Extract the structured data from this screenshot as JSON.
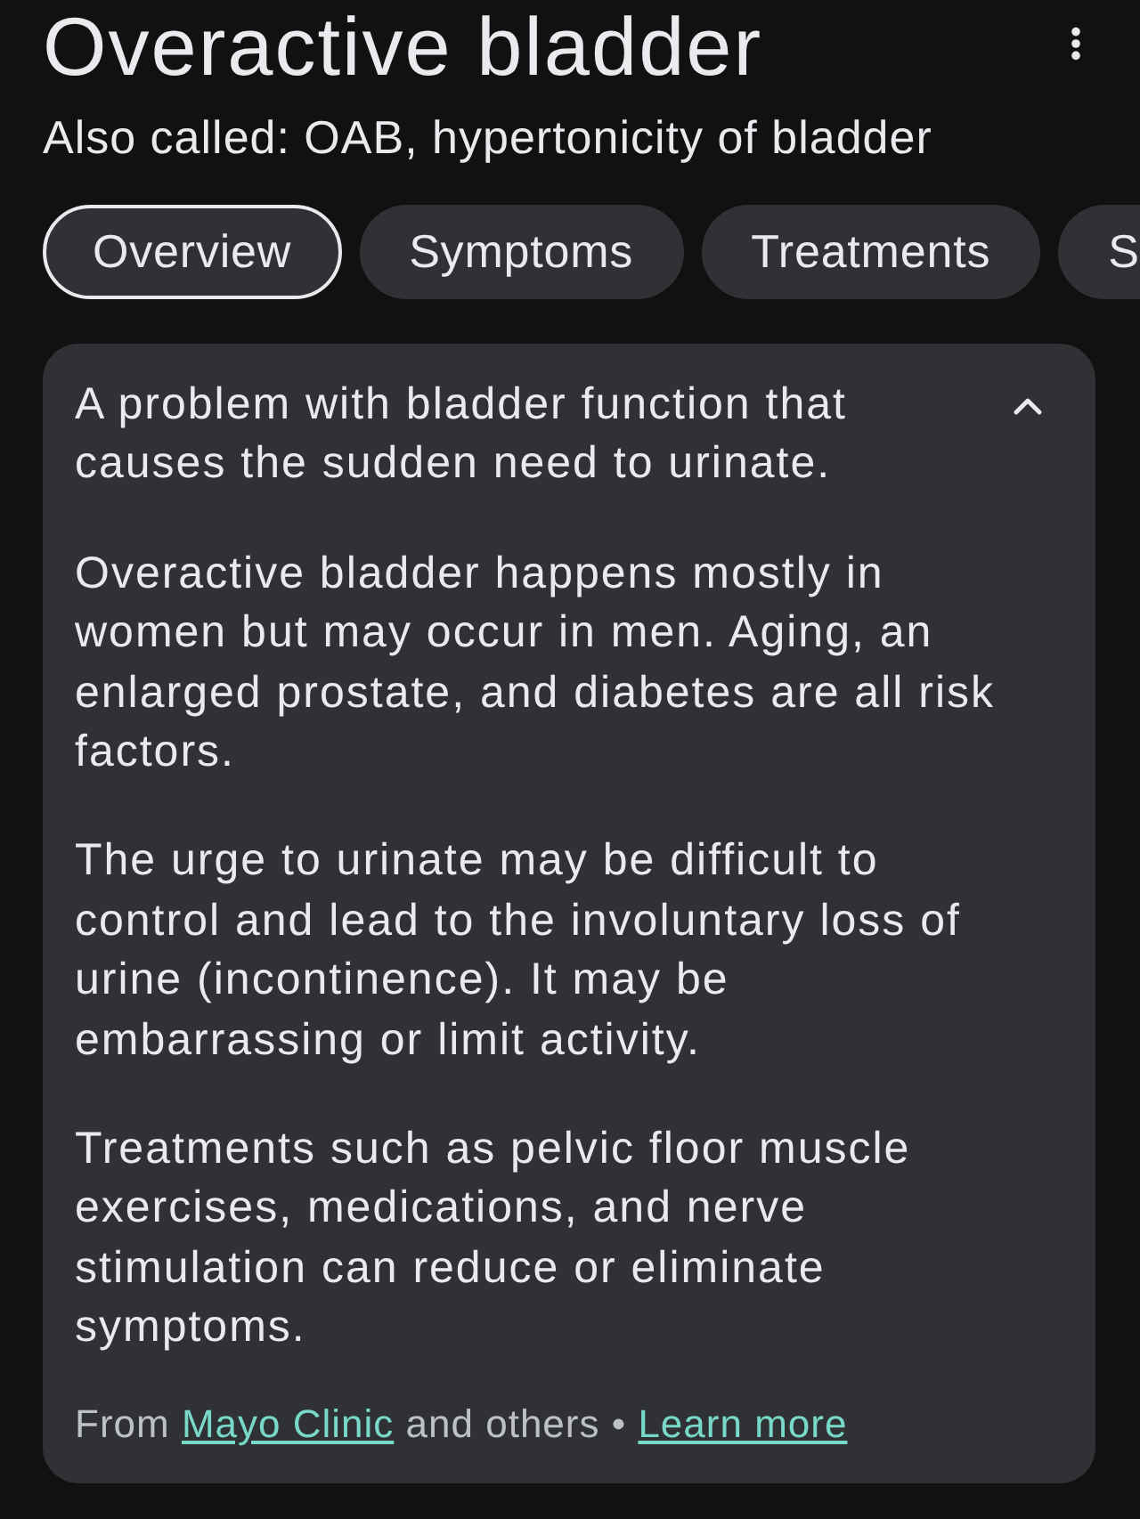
{
  "header": {
    "title": "Overactive bladder",
    "subtitle": "Also called: OAB, hypertonicity of bladder"
  },
  "tabs": [
    {
      "label": "Overview",
      "selected": true
    },
    {
      "label": "Symptoms",
      "selected": false
    },
    {
      "label": "Treatments",
      "selected": false
    },
    {
      "label": "S",
      "selected": false
    }
  ],
  "card": {
    "expanded": true,
    "paragraphs": [
      "A problem with bladder function that causes the sudden need to urinate.",
      "Overactive bladder happens mostly in women but may occur in men. Aging, an enlarged prostate, and diabetes are all risk factors.",
      "The urge to urinate may be difficult to control and lead to the involuntary loss of urine (incontinence). It may be embarrassing or limit activity.",
      "Treatments such as pelvic floor muscle exercises, medications, and nerve stimulation can reduce or eliminate symptoms."
    ],
    "source": [
      {
        "kind": "text",
        "text": "From"
      },
      {
        "kind": "link",
        "text": "Mayo Clinic"
      },
      {
        "kind": "text",
        "text": "and others •"
      },
      {
        "kind": "link",
        "text": "Learn more"
      }
    ]
  }
}
